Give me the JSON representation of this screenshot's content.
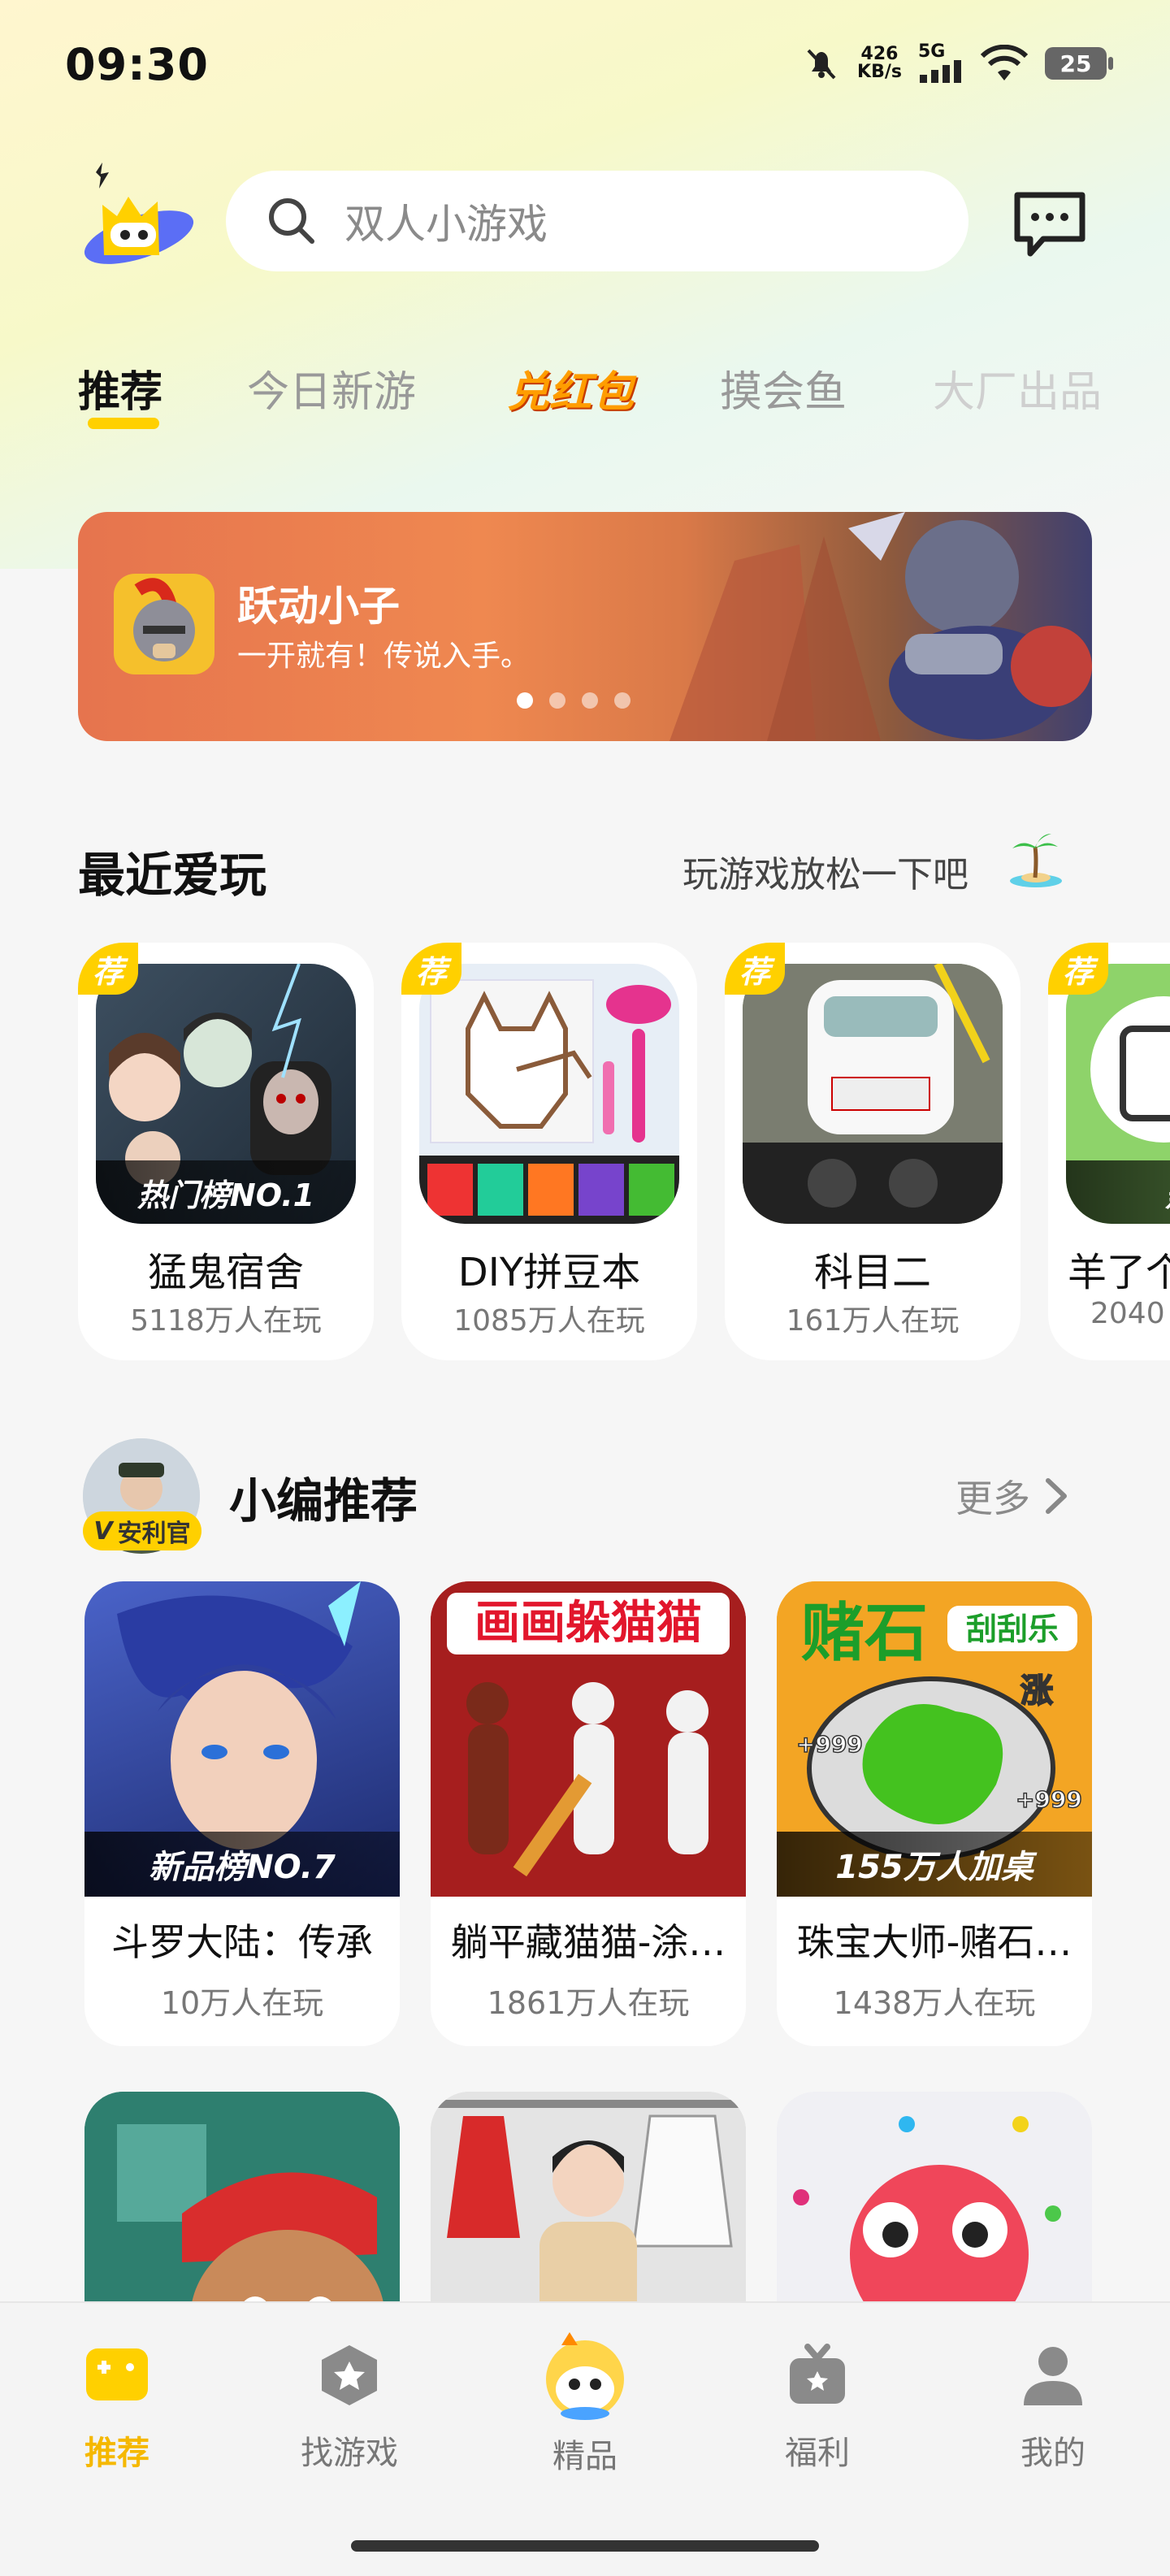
{
  "status_bar": {
    "time": "09:30",
    "net_speed_value": "426",
    "net_speed_unit": "KB/s",
    "network": "5G",
    "battery": "25",
    "icons": [
      "mute-bell-icon",
      "signal-icon",
      "wifi-icon",
      "battery-icon"
    ]
  },
  "header": {
    "search_placeholder": "双人小游戏",
    "icons": [
      "app-logo",
      "search-icon",
      "message-icon"
    ]
  },
  "tabs": [
    {
      "label": "推荐",
      "active": true
    },
    {
      "label": "今日新游",
      "active": false
    },
    {
      "label": "兑红包",
      "active": false
    },
    {
      "label": "摸会鱼",
      "active": false
    },
    {
      "label": "大厂出品",
      "active": false
    }
  ],
  "banner": {
    "title": "跃动小子",
    "subtitle": "一开就有！传说入手。",
    "dots": 4,
    "active_dot": 0
  },
  "recent": {
    "title": "最近爱玩",
    "tip": "玩游戏放松一下吧",
    "items": [
      {
        "badge": "荐",
        "rank": "热门榜NO.1",
        "name": "猛鬼宿舍",
        "players": "5118万人在玩"
      },
      {
        "badge": "荐",
        "rank": "",
        "name": "DIY拼豆本",
        "players": "1085万人在玩"
      },
      {
        "badge": "荐",
        "rank": "",
        "name": "科目二",
        "players": "161万人在玩"
      },
      {
        "badge": "荐",
        "rank": "热门",
        "name": "羊了个",
        "players": "2040"
      }
    ]
  },
  "editor": {
    "title": "小编推荐",
    "tag": "安利官",
    "more": "更多",
    "items": [
      {
        "name": "斗罗大陆：传承",
        "players": "10万人在玩",
        "strip": "新品榜NO.7"
      },
      {
        "name": "躺平藏猫猫-涂…",
        "players": "1861万人在玩",
        "strip": "",
        "art_title": "画画躲猫猫"
      },
      {
        "name": "珠宝大师-赌石…",
        "players": "1438万人在玩",
        "strip": "155万人加桌",
        "art_title": "赌石",
        "art_sub": "刮刮乐",
        "art_rise": "涨",
        "art_badge": "+999"
      }
    ]
  },
  "bottom_nav": [
    {
      "label": "推荐",
      "active": true
    },
    {
      "label": "找游戏",
      "active": false
    },
    {
      "label": "精品",
      "active": false
    },
    {
      "label": "福利",
      "active": false
    },
    {
      "label": "我的",
      "active": false
    }
  ],
  "colors": {
    "accent": "#ffd000",
    "active_nav": "#f5b800",
    "background": "#f6f6f6"
  }
}
